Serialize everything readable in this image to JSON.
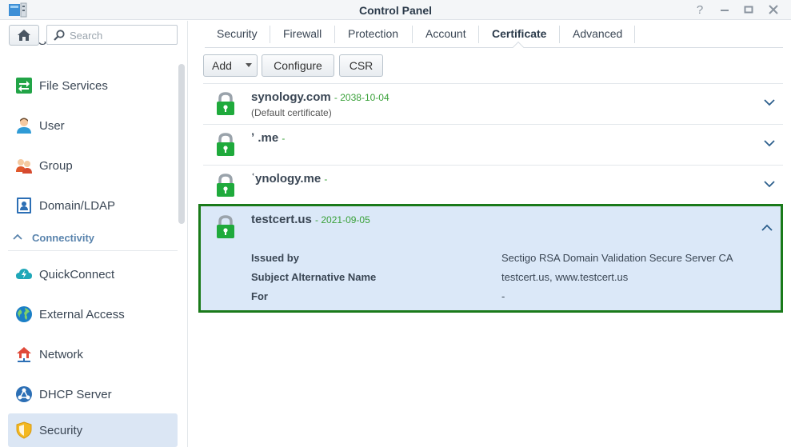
{
  "window": {
    "title": "Control Panel"
  },
  "search": {
    "placeholder": "Search"
  },
  "sidebar": {
    "partial_item": "Shared Folder",
    "items": [
      {
        "label": "File Services",
        "icon": "file-services-icon"
      },
      {
        "label": "User",
        "icon": "user-icon"
      },
      {
        "label": "Group",
        "icon": "group-icon"
      },
      {
        "label": "Domain/LDAP",
        "icon": "domain-ldap-icon"
      }
    ],
    "section": "Connectivity",
    "connectivity_items": [
      {
        "label": "QuickConnect",
        "icon": "quickconnect-icon"
      },
      {
        "label": "External Access",
        "icon": "external-access-icon"
      },
      {
        "label": "Network",
        "icon": "network-icon"
      },
      {
        "label": "DHCP Server",
        "icon": "dhcp-server-icon"
      },
      {
        "label": "Security",
        "icon": "security-shield-icon",
        "active": true
      }
    ]
  },
  "tabs": [
    "Security",
    "Firewall",
    "Protection",
    "Account",
    "Certificate",
    "Advanced"
  ],
  "active_tab": "Certificate",
  "toolbar": {
    "add": "Add",
    "configure": "Configure",
    "csr": "CSR"
  },
  "certificates": [
    {
      "name": "synology.com",
      "date": "- 2038-10-04",
      "subtitle": "(Default certificate)"
    },
    {
      "name": "ʼ                  .me",
      "date": "- ",
      "subtitle": ""
    },
    {
      "name": "            ʿynology.me",
      "date": "- ",
      "subtitle": ""
    }
  ],
  "expanded_certificate": {
    "name": "testcert.us",
    "date": "- 2021-09-05",
    "details": [
      {
        "label": "Issued by",
        "value": "Sectigo RSA Domain Validation Secure Server CA"
      },
      {
        "label": "Subject Alternative Name",
        "value": "testcert.us, www.testcert.us"
      },
      {
        "label": "For",
        "value": "-"
      }
    ]
  },
  "colors": {
    "accent": "#5a84ad",
    "date_green": "#3aa13a",
    "selection_bg": "#dbe8f8",
    "highlight_border": "#1a7a1a",
    "lock_green": "#1faa3c"
  }
}
